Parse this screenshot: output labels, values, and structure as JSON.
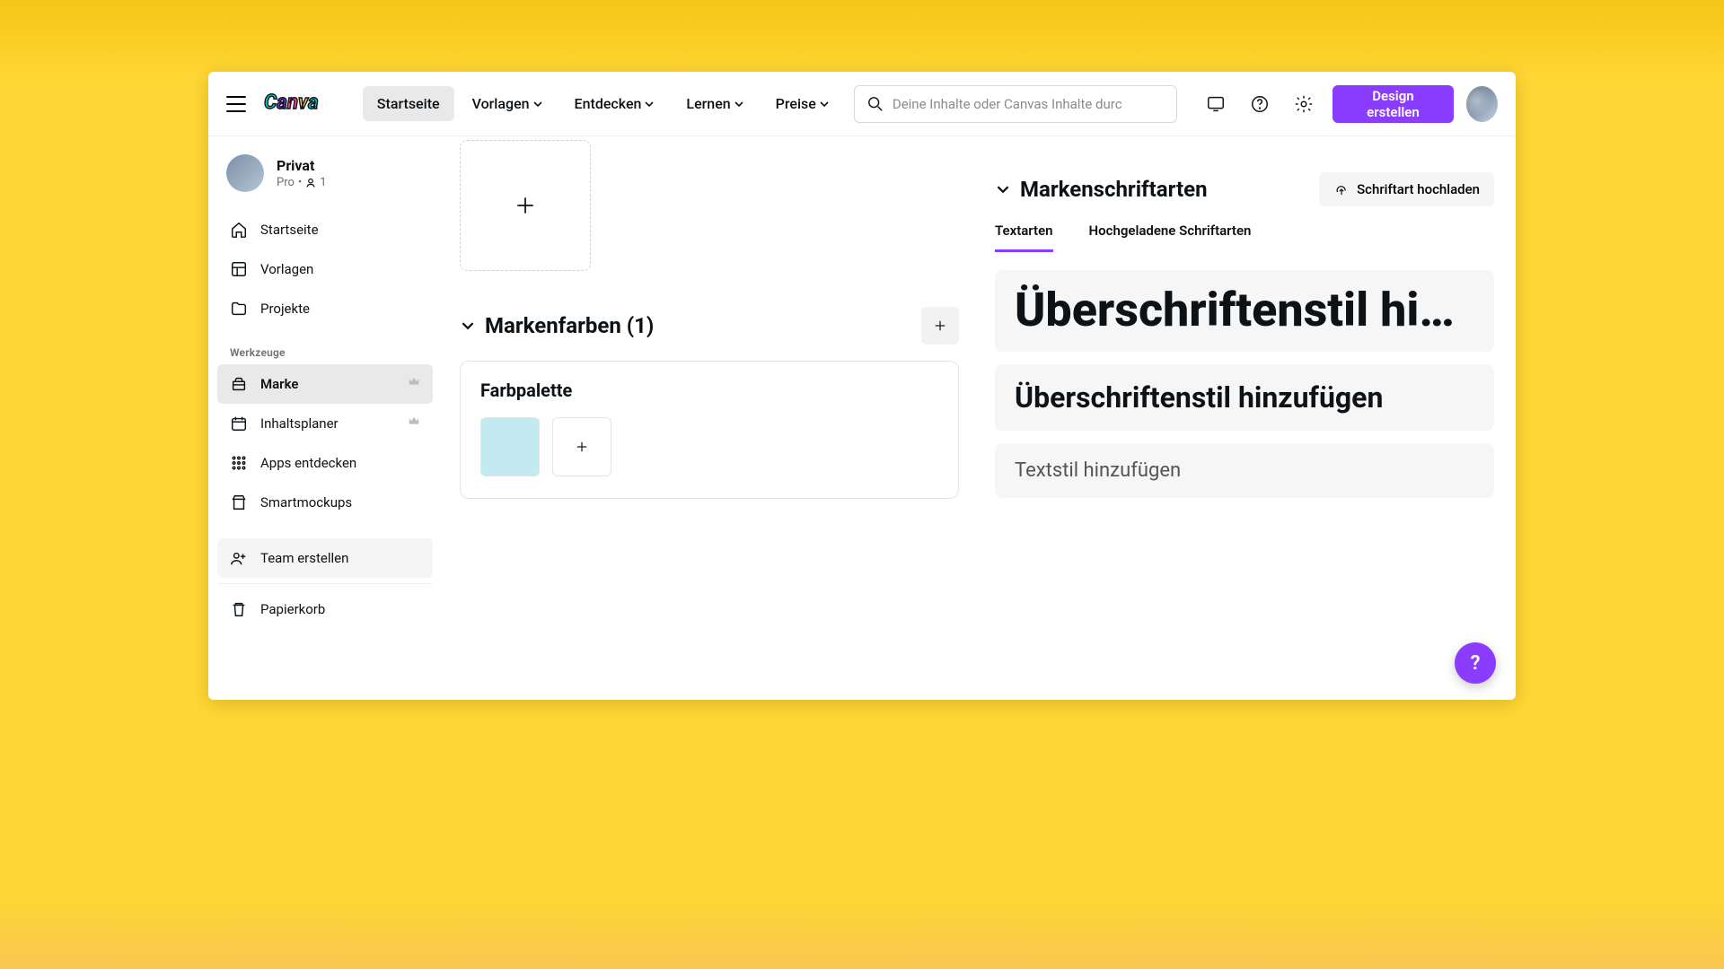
{
  "nav": {
    "home": "Startseite",
    "templates": "Vorlagen",
    "discover": "Entdecken",
    "learn": "Lernen",
    "pricing": "Preise"
  },
  "search": {
    "placeholder": "Deine Inhalte oder Canvas Inhalte durc"
  },
  "primary_button": "Design erstellen",
  "team": {
    "name": "Privat",
    "plan": "Pro",
    "members": "1"
  },
  "sidebar": {
    "home": "Startseite",
    "templates": "Vorlagen",
    "projects": "Projekte",
    "tools_label": "Werkzeuge",
    "brand": "Marke",
    "planner": "Inhaltsplaner",
    "apps": "Apps entdecken",
    "smartmockups": "Smartmockups",
    "team_create": "Team erstellen",
    "trash": "Papierkorb"
  },
  "brand_colors": {
    "title": "Markenfarben (1)",
    "palette_title": "Farbpalette",
    "swatches": [
      "#c3eaf0"
    ]
  },
  "brand_fonts": {
    "title": "Markenschriftarten",
    "upload_label": "Schriftart hochladen",
    "tabs": {
      "text_types": "Textarten",
      "uploaded": "Hochgeladene Schriftarten"
    },
    "style_h1": "Überschriftenstil hi…",
    "style_h2": "Überschriftenstil hinzufügen",
    "style_body": "Textstil hinzufügen"
  },
  "help_fab": "?"
}
